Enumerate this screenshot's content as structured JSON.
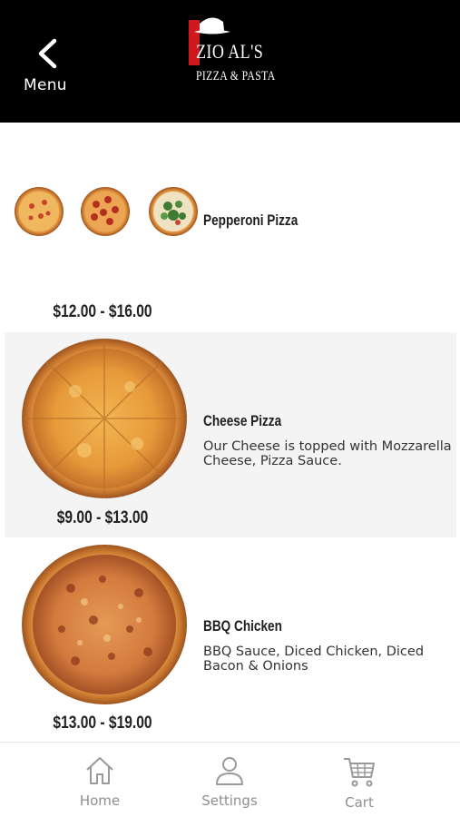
{
  "header": {
    "back_label": "Menu",
    "logo_main": "ZIO AL'S",
    "logo_sub": "PIZZA & PASTA"
  },
  "items": [
    {
      "title": "Pepperoni Pizza",
      "description": "",
      "price": "$12.00 - $16.00"
    },
    {
      "title": "Cheese Pizza",
      "description": "Our Cheese is topped with Mozzarella Cheese, Pizza Sauce.",
      "price": "$9.00 - $13.00"
    },
    {
      "title": "BBQ Chicken",
      "description": "BBQ Sauce, Diced Chicken, Diced Bacon & Onions",
      "price": "$13.00 - $19.00"
    }
  ],
  "tabbar": {
    "tabs": [
      {
        "label": "Home",
        "icon": "home-icon"
      },
      {
        "label": "Settings",
        "icon": "user-icon"
      },
      {
        "label": "Cart",
        "icon": "cart-icon"
      }
    ]
  },
  "colors": {
    "header_bg": "#000000",
    "logo_red": "#d0181f",
    "row_alt_bg": "#f4f4f4",
    "tab_gray": "#8f8f8f"
  }
}
